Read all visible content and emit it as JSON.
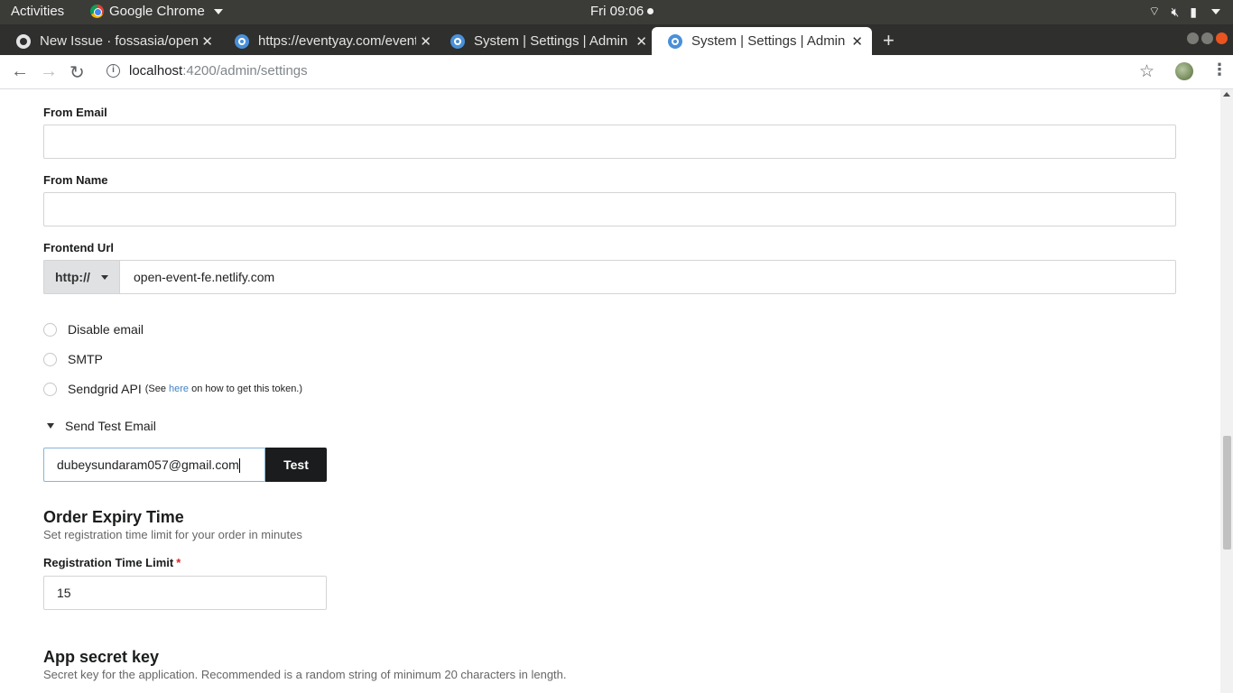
{
  "os": {
    "activities": "Activities",
    "app_name": "Google Chrome",
    "clock": "Fri 09:06"
  },
  "browser": {
    "tabs": [
      {
        "title": "New Issue · fossasia/open-event-frontend",
        "favicon": "github-icon"
      },
      {
        "title": "https://eventyay.com/events",
        "favicon": "eventyay-icon"
      },
      {
        "title": "System | Settings | Admin",
        "favicon": "eventyay-icon"
      },
      {
        "title": "System | Settings | Admin",
        "favicon": "eventyay-icon",
        "active": true
      }
    ],
    "url_host": "localhost",
    "url_path": ":4200/admin/settings"
  },
  "form": {
    "from_email": {
      "label": "From Email",
      "value": ""
    },
    "from_name": {
      "label": "From Name",
      "value": ""
    },
    "frontend_url": {
      "label": "Frontend Url",
      "protocol": "http://",
      "value": "open-event-fe.netlify.com"
    },
    "email_options": [
      {
        "label": "Disable email"
      },
      {
        "label": "SMTP"
      },
      {
        "label": "Sendgrid API",
        "note_prefix": "(See ",
        "note_link": "here",
        "note_suffix": " on how to get this token.)"
      }
    ],
    "send_test": {
      "toggle_label": "Send Test Email",
      "email_value": "dubeysundaram057@gmail.com",
      "button_label": "Test"
    }
  },
  "order_expiry": {
    "heading": "Order Expiry Time",
    "description": "Set registration time limit for your order in minutes",
    "field_label": "Registration Time Limit",
    "required_mark": "*",
    "value": "15"
  },
  "app_secret": {
    "heading": "App secret key",
    "description": "Secret key for the application. Recommended is a random string of minimum 20 characters in length."
  },
  "colors": {
    "accent_link": "#4183c4",
    "button_dark": "#1b1c1d",
    "required": "#db2828"
  }
}
